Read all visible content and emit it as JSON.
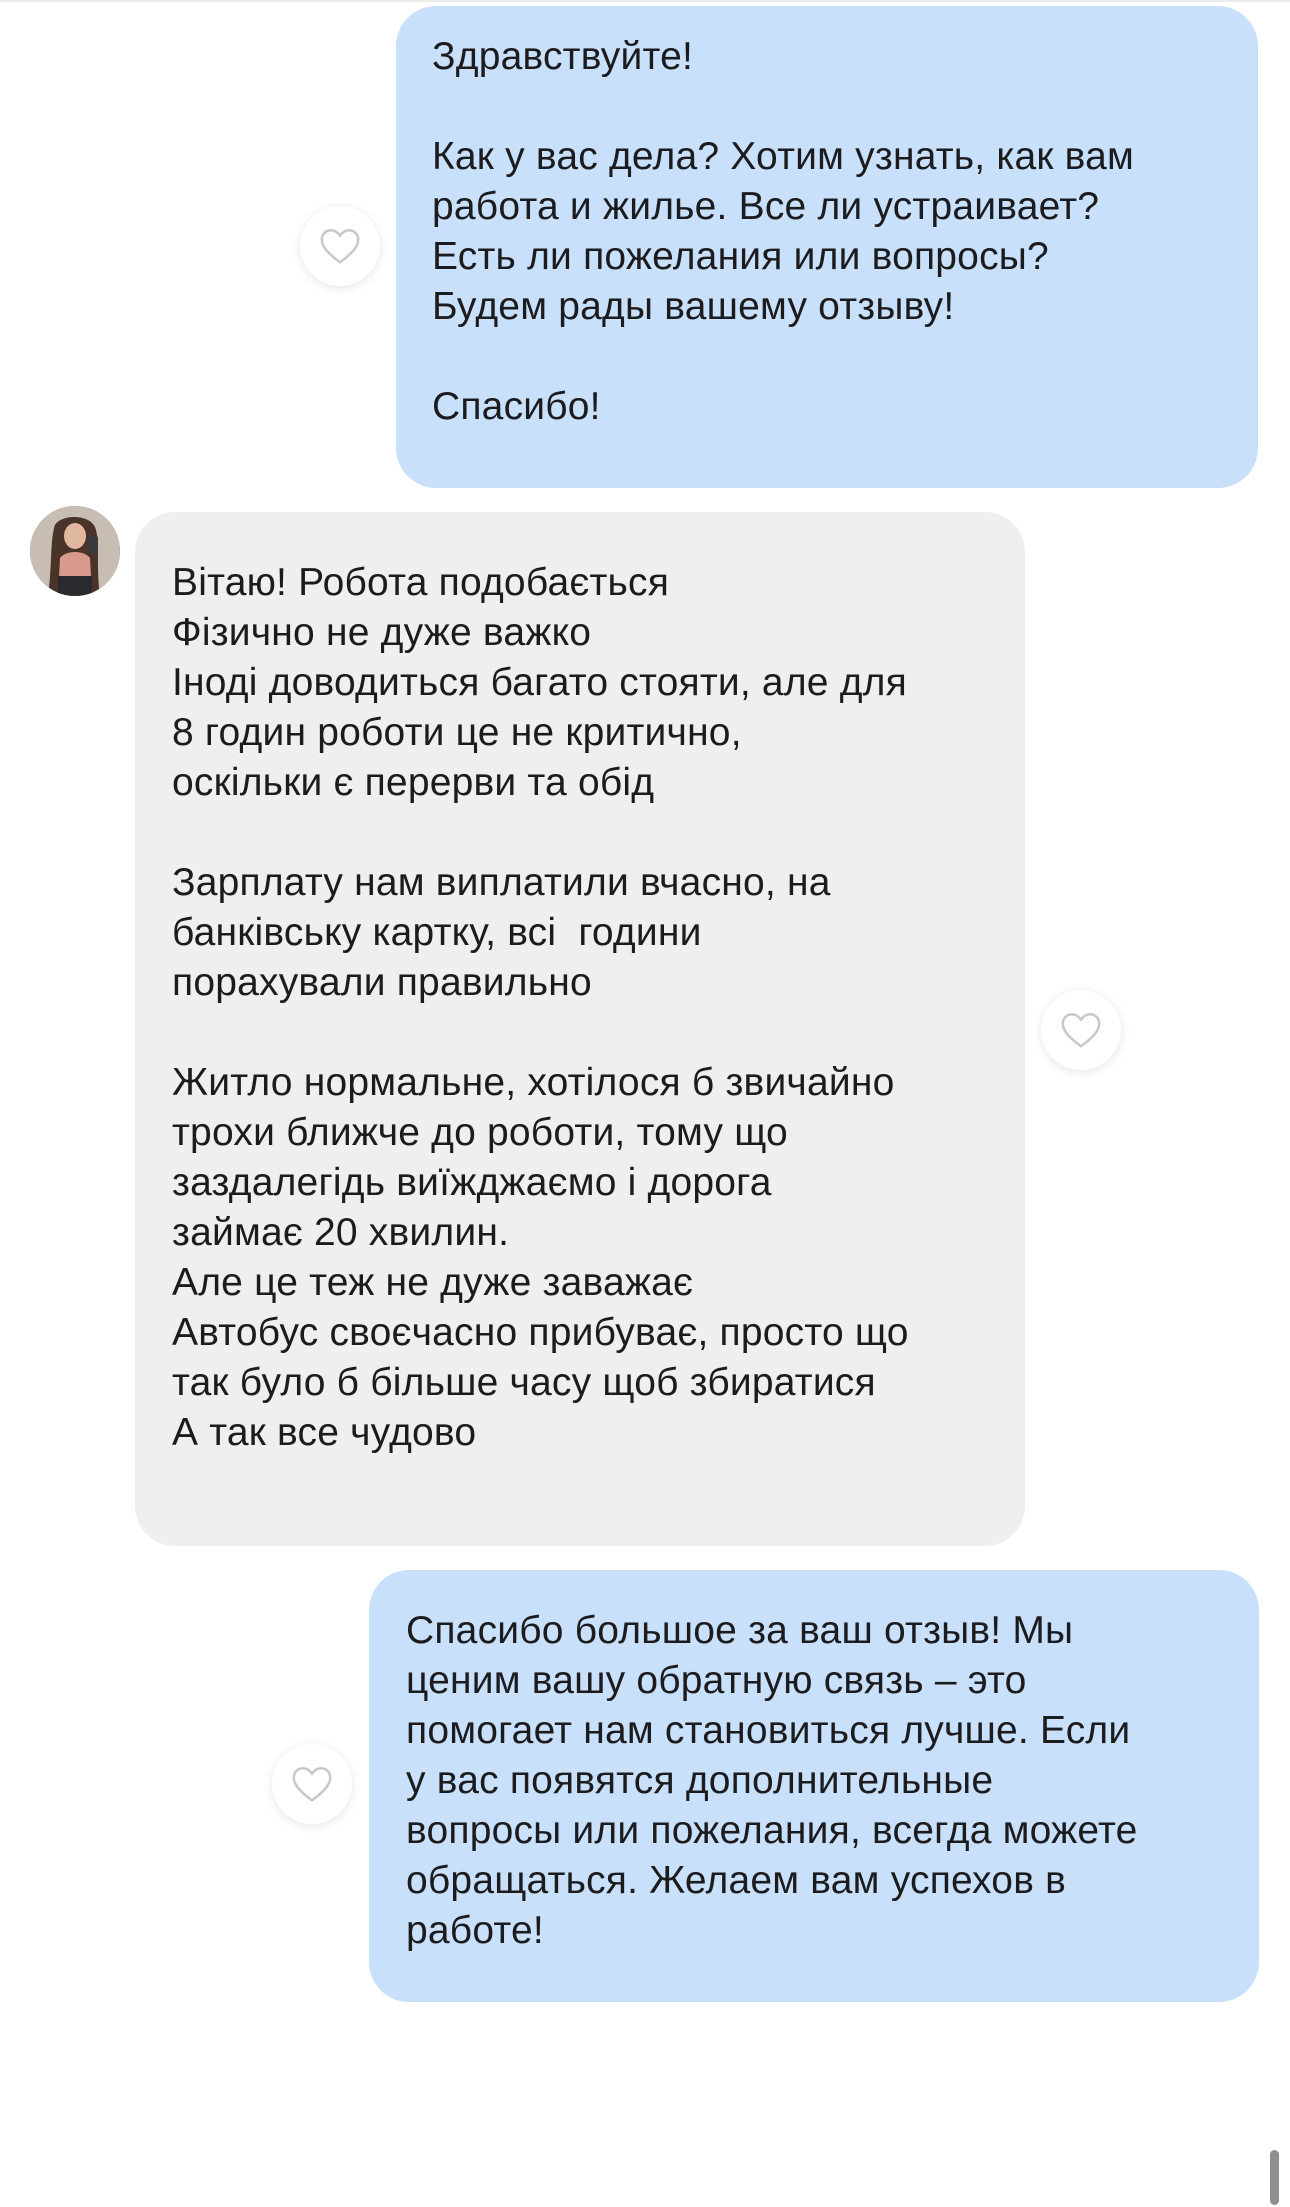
{
  "messages": [
    {
      "direction": "outgoing",
      "lines": [
        "Здравствуйте!",
        "",
        "Как у вас дела? Хотим узнать, как вам",
        "работа и жилье. Все ли устраивает?",
        "Есть ли пожелания или вопросы?",
        "Будем рады вашему отзыву!",
        "",
        "Спасибо!"
      ]
    },
    {
      "direction": "incoming",
      "lines": [
        "Вітаю! Робота подобається",
        "Фізично не дуже важко",
        "Іноді доводиться багато стояти, але для",
        "8 годин роботи це не критично,",
        "оскільки є перерви та обід",
        "",
        "Зарплату нам виплатили вчасно, на",
        "банківську картку, всі  години",
        "порахували правильно",
        "",
        "Житло нормальне, хотілося б звичайно",
        "трохи ближче до роботи, тому що",
        "заздалегідь виїжджаємо і дорога",
        "займає 20 хвилин.",
        "Але це теж не дуже заважає",
        "Автобус своєчасно прибуває, просто що",
        "так було б більше часу щоб збиратися",
        "А так все чудово"
      ]
    },
    {
      "direction": "outgoing",
      "lines": [
        "Спасибо большое за ваш отзыв! Мы",
        "ценим вашу обратную связь – это",
        "помогает нам становиться лучше. Если",
        "у вас появятся дополнительные",
        "вопросы или пожелания, всегда можете",
        "обращаться. Желаем вам успехов в",
        "работе!"
      ]
    }
  ],
  "icons": {
    "like": "heart-outline-icon",
    "avatar": "contact-avatar-photo"
  },
  "colors": {
    "outgoing_bubble": "#c9e0fb",
    "incoming_bubble": "#efefef",
    "text": "#1c1c1e",
    "heart_stroke": "#c7c7cc",
    "scrollbar": "#8e8e93"
  }
}
